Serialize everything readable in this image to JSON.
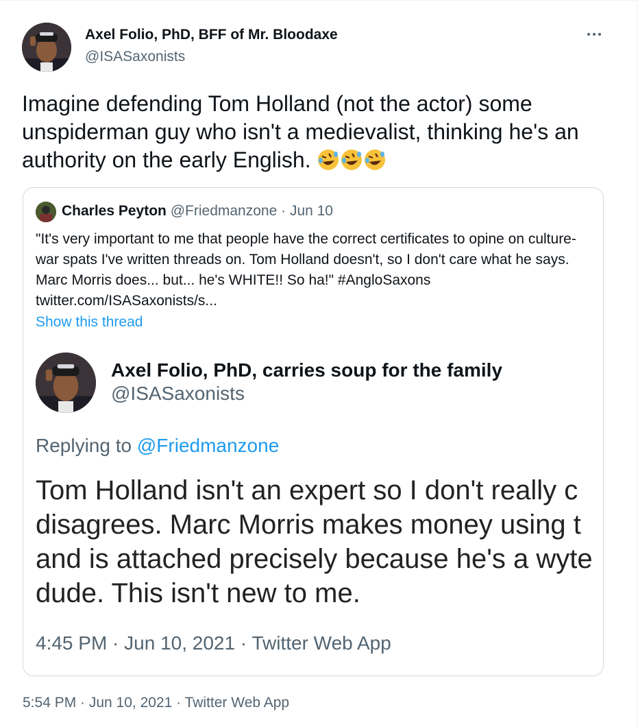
{
  "author": {
    "name": "Axel Folio, PhD, BFF of Mr. Bloodaxe",
    "handle": "@ISASaxonists"
  },
  "tweet": {
    "text": "Imagine defending Tom Holland (not the actor) some unspiderman guy who isn't a medievalist, thinking he's an authority on the early English. ",
    "emoji_icon": "rolling-on-floor-laughing-icon",
    "timestamp": "5:54 PM · Jun 10, 2021 · Twitter Web App"
  },
  "quote": {
    "name": "Charles Peyton",
    "meta": " @Friedmanzone · Jun 10",
    "text": "\"It's very important to me that people have the correct certificates to opine on culture-war spats I've written threads on. Tom Holland doesn't, so I don't care what he says. Marc Morris does... but... he's WHITE!! So ha!\" #AngloSaxons twitter.com/ISASaxonists/s...",
    "show_thread": "Show this thread"
  },
  "screenshot": {
    "name": "Axel Folio, PhD, carries soup for the family",
    "handle": "@ISASaxonists",
    "replying_prefix": "Replying to ",
    "replying_to": "@Friedmanzone",
    "text": "Tom Holland isn't an expert so I don't really c\ndisagrees. Marc Morris makes money using t\nand is attached precisely because he's a wyte\ndude. This isn't new to me.",
    "timestamp": "4:45 PM · Jun 10, 2021 · Twitter Web App"
  },
  "colors": {
    "link": "#1d9bf0",
    "secondary_text": "#536471",
    "border": "#cfd9de"
  }
}
